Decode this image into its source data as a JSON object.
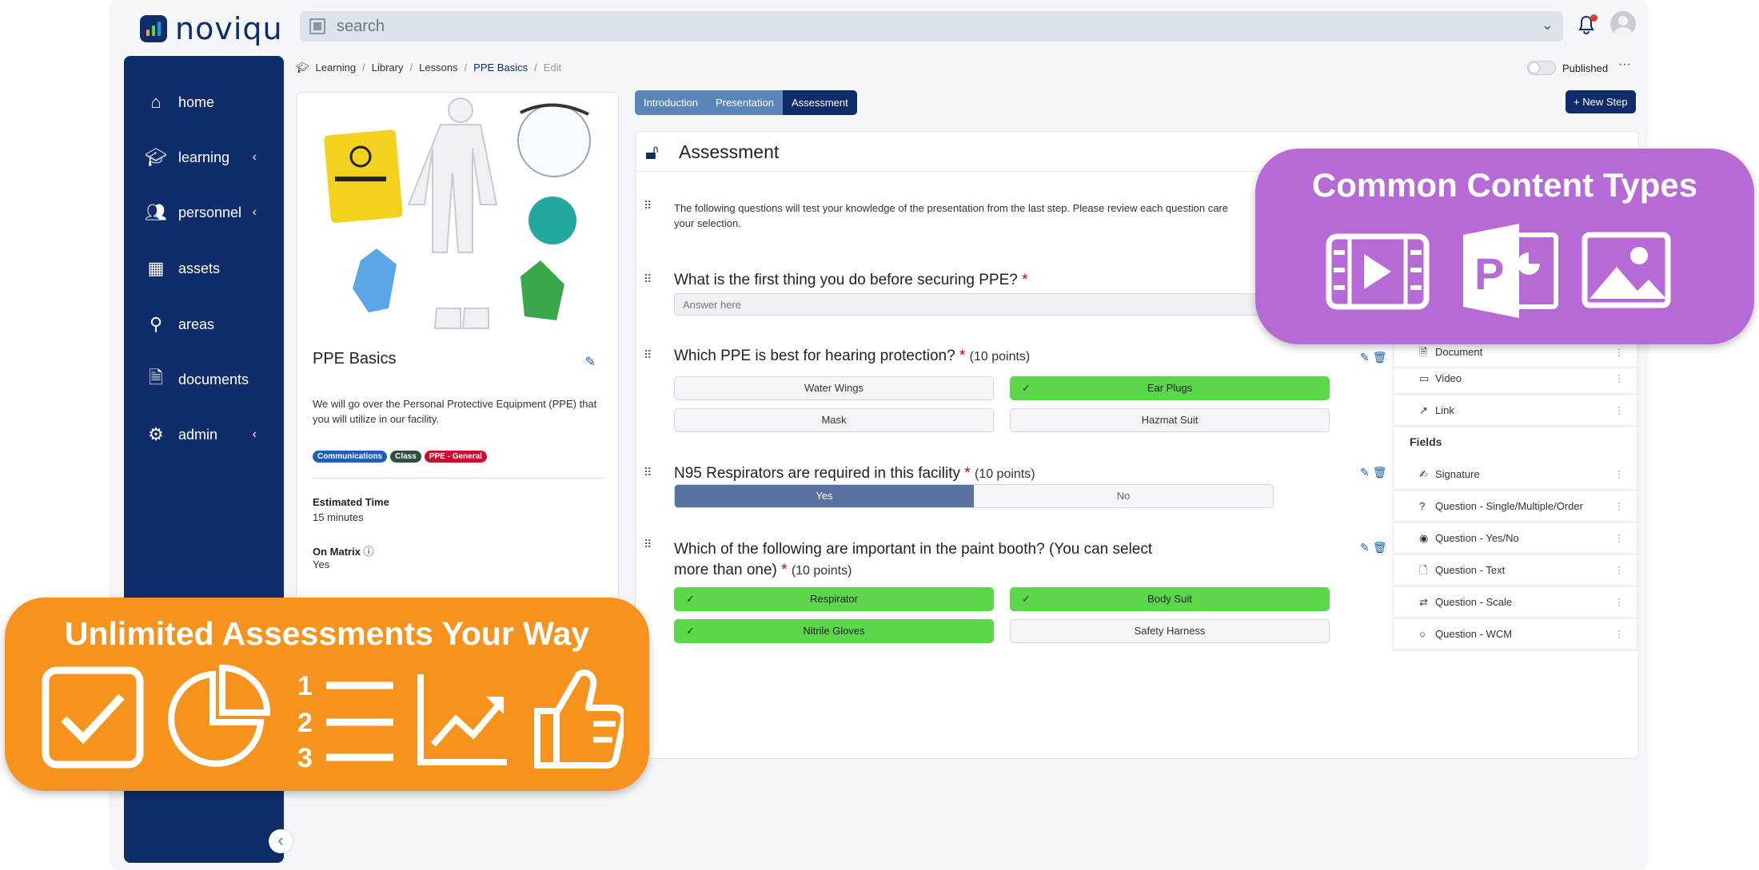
{
  "brand": {
    "name": "noviqu"
  },
  "search": {
    "placeholder": "search"
  },
  "sidebar": {
    "items": [
      {
        "label": "home",
        "icon": "home-icon"
      },
      {
        "label": "learning",
        "icon": "graduation-cap-icon"
      },
      {
        "label": "personnel",
        "icon": "users-icon"
      },
      {
        "label": "assets",
        "icon": "grid-icon"
      },
      {
        "label": "areas",
        "icon": "map-pin-icon"
      },
      {
        "label": "documents",
        "icon": "document-search-icon"
      },
      {
        "label": "admin",
        "icon": "gear-icon"
      }
    ]
  },
  "breadcrumb": {
    "items": [
      "Learning",
      "Library",
      "Lessons",
      "PPE Basics",
      "Edit"
    ]
  },
  "publish": {
    "label": "Published"
  },
  "lesson": {
    "title": "PPE Basics",
    "description": "We will go over the Personal Protective Equipment (PPE) that you will utilize in our facility.",
    "tags": [
      {
        "label": "Communications",
        "color": "#1c5fb8"
      },
      {
        "label": "Class",
        "color": "#2e4f3e"
      },
      {
        "label": "PPE - General",
        "color": "#c8102e"
      }
    ],
    "estimated_time_label": "Estimated Time",
    "estimated_time": "15 minutes",
    "on_matrix_label": "On Matrix",
    "on_matrix": "Yes"
  },
  "tabs": [
    "Introduction",
    "Presentation",
    "Assessment"
  ],
  "new_step": "+ New Step",
  "assessment": {
    "title": "Assessment",
    "intro": "The following questions will test your knowledge of the presentation from the last step. Please review each question care",
    "intro2": "your selection.",
    "q1": {
      "text": "What is the first thing you do before securing PPE?",
      "req": "*",
      "placeholder": "Answer here"
    },
    "q2": {
      "text": "Which PPE is best for hearing protection?",
      "req": "*",
      "points": "(10 points)",
      "options": [
        "Water Wings",
        "Ear Plugs",
        "Mask",
        "Hazmat Suit"
      ],
      "selected": [
        1
      ]
    },
    "q3": {
      "text": "N95 Respirators are required in this facility",
      "req": "*",
      "points": "(10 points)",
      "yes": "Yes",
      "no": "No",
      "value": "Yes"
    },
    "q4": {
      "text1": "Which of the following are important in the paint booth? (You can select",
      "text2": "more than one)",
      "req": "*",
      "points": "(10 points)",
      "options": [
        "Respirator",
        "Body Suit",
        "Nitrile Gloves",
        "Safety Harness"
      ],
      "selected": [
        0,
        1,
        2
      ]
    }
  },
  "panel": {
    "items": [
      "Document",
      "Video",
      "Link"
    ],
    "fields_label": "Fields",
    "fields": [
      "Signature",
      "Question - Single/Multiple/Order",
      "Question - Yes/No",
      "Question - Text",
      "Question - Scale",
      "Question - WCM"
    ]
  },
  "promo_purple": {
    "title": "Common Content Types",
    "color": "#b56ad6"
  },
  "promo_orange": {
    "title": "Unlimited Assessments Your Way",
    "color": "#f6931e"
  }
}
